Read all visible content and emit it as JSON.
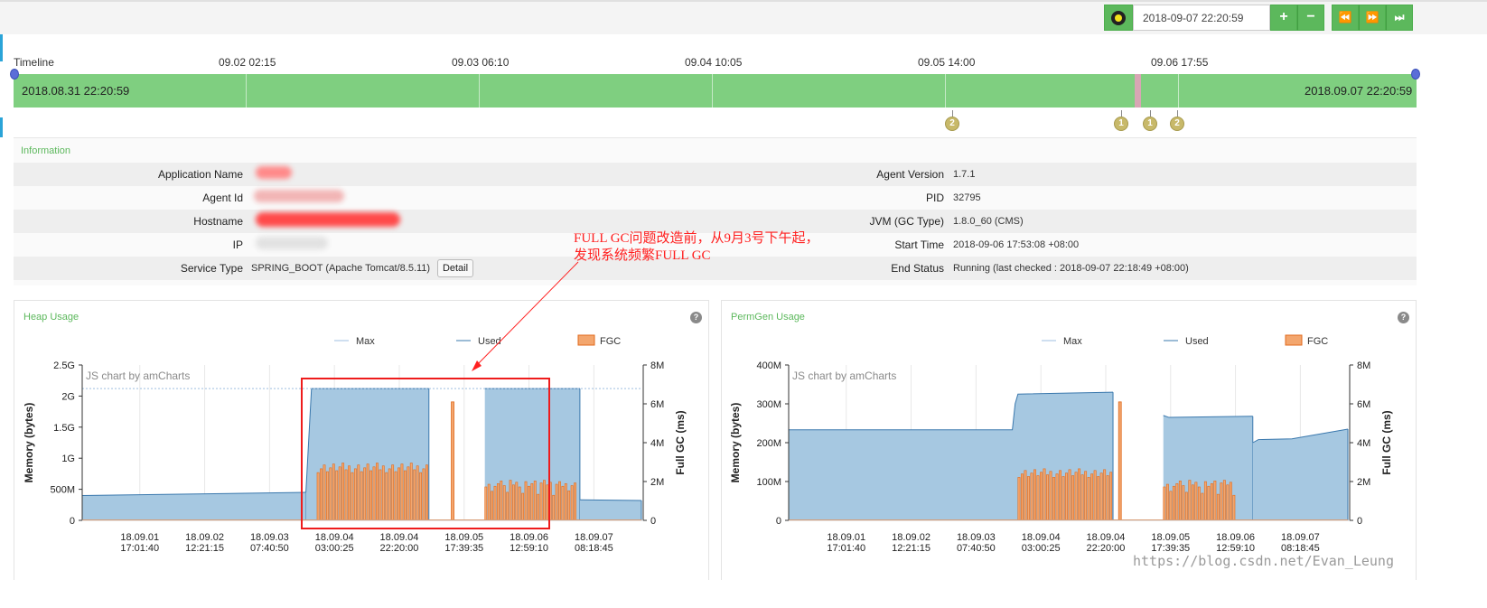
{
  "toolbar": {
    "datetime_value": "2018-09-07 22:20:59",
    "buttons": {
      "zoom_in": "+",
      "zoom_out": "−",
      "rewind": "⏪",
      "forward": "⏩",
      "fast_forward": "⏭"
    },
    "colors": {
      "button_green": "#5cb85c"
    }
  },
  "timeline": {
    "label": "Timeline",
    "ticks": [
      "09.02 02:15",
      "09.03 06:10",
      "09.04 10:05",
      "09.05 14:00",
      "09.06 17:55"
    ],
    "start": "2018.08.31 22:20:59",
    "end": "2018.09.07 22:20:59",
    "events": [
      "2",
      "1",
      "1",
      "2"
    ],
    "colors": {
      "bar": "#7fcf80",
      "selection": "#d8a6b4"
    }
  },
  "information": {
    "title": "Information",
    "left": [
      {
        "label": "Application Name",
        "value": ""
      },
      {
        "label": "Agent Id",
        "value": ""
      },
      {
        "label": "Hostname",
        "value": ""
      },
      {
        "label": "IP",
        "value": ""
      },
      {
        "label": "Service Type",
        "value": "SPRING_BOOT  (Apache Tomcat/8.5.11)"
      }
    ],
    "right": [
      {
        "label": "Agent Version",
        "value": "1.7.1"
      },
      {
        "label": "PID",
        "value": "32795"
      },
      {
        "label": "JVM (GC Type)",
        "value": "1.8.0_60 (CMS)"
      },
      {
        "label": "Start Time",
        "value": "2018-09-06 17:53:08 +08:00"
      },
      {
        "label": "End Status",
        "value": "Running (last checked : 2018-09-07 22:18:49 +08:00)"
      }
    ],
    "detail_button": "Detail"
  },
  "annotation": {
    "line1": "FULL GC问题改造前，从9月3号下午起，",
    "line2": "发现系统频繁FULL GC"
  },
  "watermark": "https://blog.csdn.net/Evan_Leung",
  "chart_data": [
    {
      "type": "area",
      "title": "Heap Usage",
      "credit": "JS chart by amCharts",
      "legend": [
        "Max",
        "Used",
        "FGC"
      ],
      "legend_position": "top",
      "ylabel": "Memory (bytes)",
      "y2label": "Full GC (ms)",
      "y_ticks": [
        "0",
        "500M",
        "1G",
        "1.5G",
        "2G",
        "2.5G"
      ],
      "y_max": 2.5,
      "y2_ticks": [
        "0",
        "2M",
        "4M",
        "6M",
        "8M"
      ],
      "y2_max": 8,
      "x_ticks": [
        [
          "18.09.01",
          "17:01:40"
        ],
        [
          "18.09.02",
          "12:21:15"
        ],
        [
          "18.09.03",
          "07:40:50"
        ],
        [
          "18.09.04",
          "03:00:25"
        ],
        [
          "18.09.04",
          "22:20:00"
        ],
        [
          "18.09.05",
          "17:39:35"
        ],
        [
          "18.09.06",
          "12:59:10"
        ],
        [
          "18.09.07",
          "08:18:45"
        ]
      ],
      "max_value": 2.12,
      "used_segments": [
        {
          "x": [
            0,
            0.4
          ],
          "y": [
            0.4,
            0.45
          ]
        },
        {
          "x": [
            0.4,
            0.41,
            0.62
          ],
          "y": [
            0.45,
            2.12,
            2.12
          ]
        },
        {
          "x": [
            0.72,
            0.89
          ],
          "y": [
            2.12,
            2.12
          ]
        },
        {
          "x": [
            0.89,
            1.0
          ],
          "y": [
            0.33,
            0.32
          ]
        }
      ],
      "fgc_series": [
        {
          "x": [
            0.42,
            0.62
          ],
          "y": 3.0
        },
        {
          "x": [
            0.66,
            0.665
          ],
          "y": 6.1
        },
        {
          "x": [
            0.72,
            0.885
          ],
          "y": 2.1
        }
      ],
      "x_range": [
        0,
        1
      ],
      "highlight": true,
      "colors": {
        "used_fill": "#a6c8e1",
        "used_line": "#3a78ad",
        "max_line": "#9fbfe0",
        "fgc_fill": "#f3a66e",
        "fgc_line": "#e06a1c"
      }
    },
    {
      "type": "area",
      "title": "PermGen Usage",
      "credit": "JS chart by amCharts",
      "legend": [
        "Max",
        "Used",
        "FGC"
      ],
      "legend_position": "top",
      "ylabel": "Memory (bytes)",
      "y2label": "Full GC (ms)",
      "y_ticks": [
        "0",
        "100M",
        "200M",
        "300M",
        "400M"
      ],
      "y_max": 400,
      "y2_ticks": [
        "0",
        "2M",
        "4M",
        "6M",
        "8M"
      ],
      "y2_max": 8,
      "x_ticks": [
        [
          "18.09.01",
          "17:01:40"
        ],
        [
          "18.09.02",
          "12:21:15"
        ],
        [
          "18.09.03",
          "07:40:50"
        ],
        [
          "18.09.04",
          "03:00:25"
        ],
        [
          "18.09.04",
          "22:20:00"
        ],
        [
          "18.09.05",
          "17:39:35"
        ],
        [
          "18.09.06",
          "12:59:10"
        ],
        [
          "18.09.07",
          "08:18:45"
        ]
      ],
      "used_segments": [
        {
          "x": [
            0,
            0.4,
            0.405,
            0.41,
            0.58
          ],
          "y": [
            233,
            233,
            300,
            325,
            330
          ]
        },
        {
          "x": [
            0.67,
            0.68,
            0.83
          ],
          "y": [
            270,
            265,
            268
          ]
        },
        {
          "x": [
            0.83,
            0.84,
            0.9,
            1.0
          ],
          "y": [
            200,
            208,
            210,
            235
          ]
        }
      ],
      "fgc_series": [
        {
          "x": [
            0.41,
            0.58
          ],
          "y": 2.7
        },
        {
          "x": [
            0.59,
            0.595
          ],
          "y": 6.1
        },
        {
          "x": [
            0.67,
            0.8
          ],
          "y": 2.1
        }
      ],
      "x_range": [
        0,
        1
      ],
      "highlight": false,
      "colors": {
        "used_fill": "#a6c8e1",
        "used_line": "#3a78ad",
        "max_line": "#9fbfe0",
        "fgc_fill": "#f3a66e",
        "fgc_line": "#e06a1c"
      }
    }
  ]
}
